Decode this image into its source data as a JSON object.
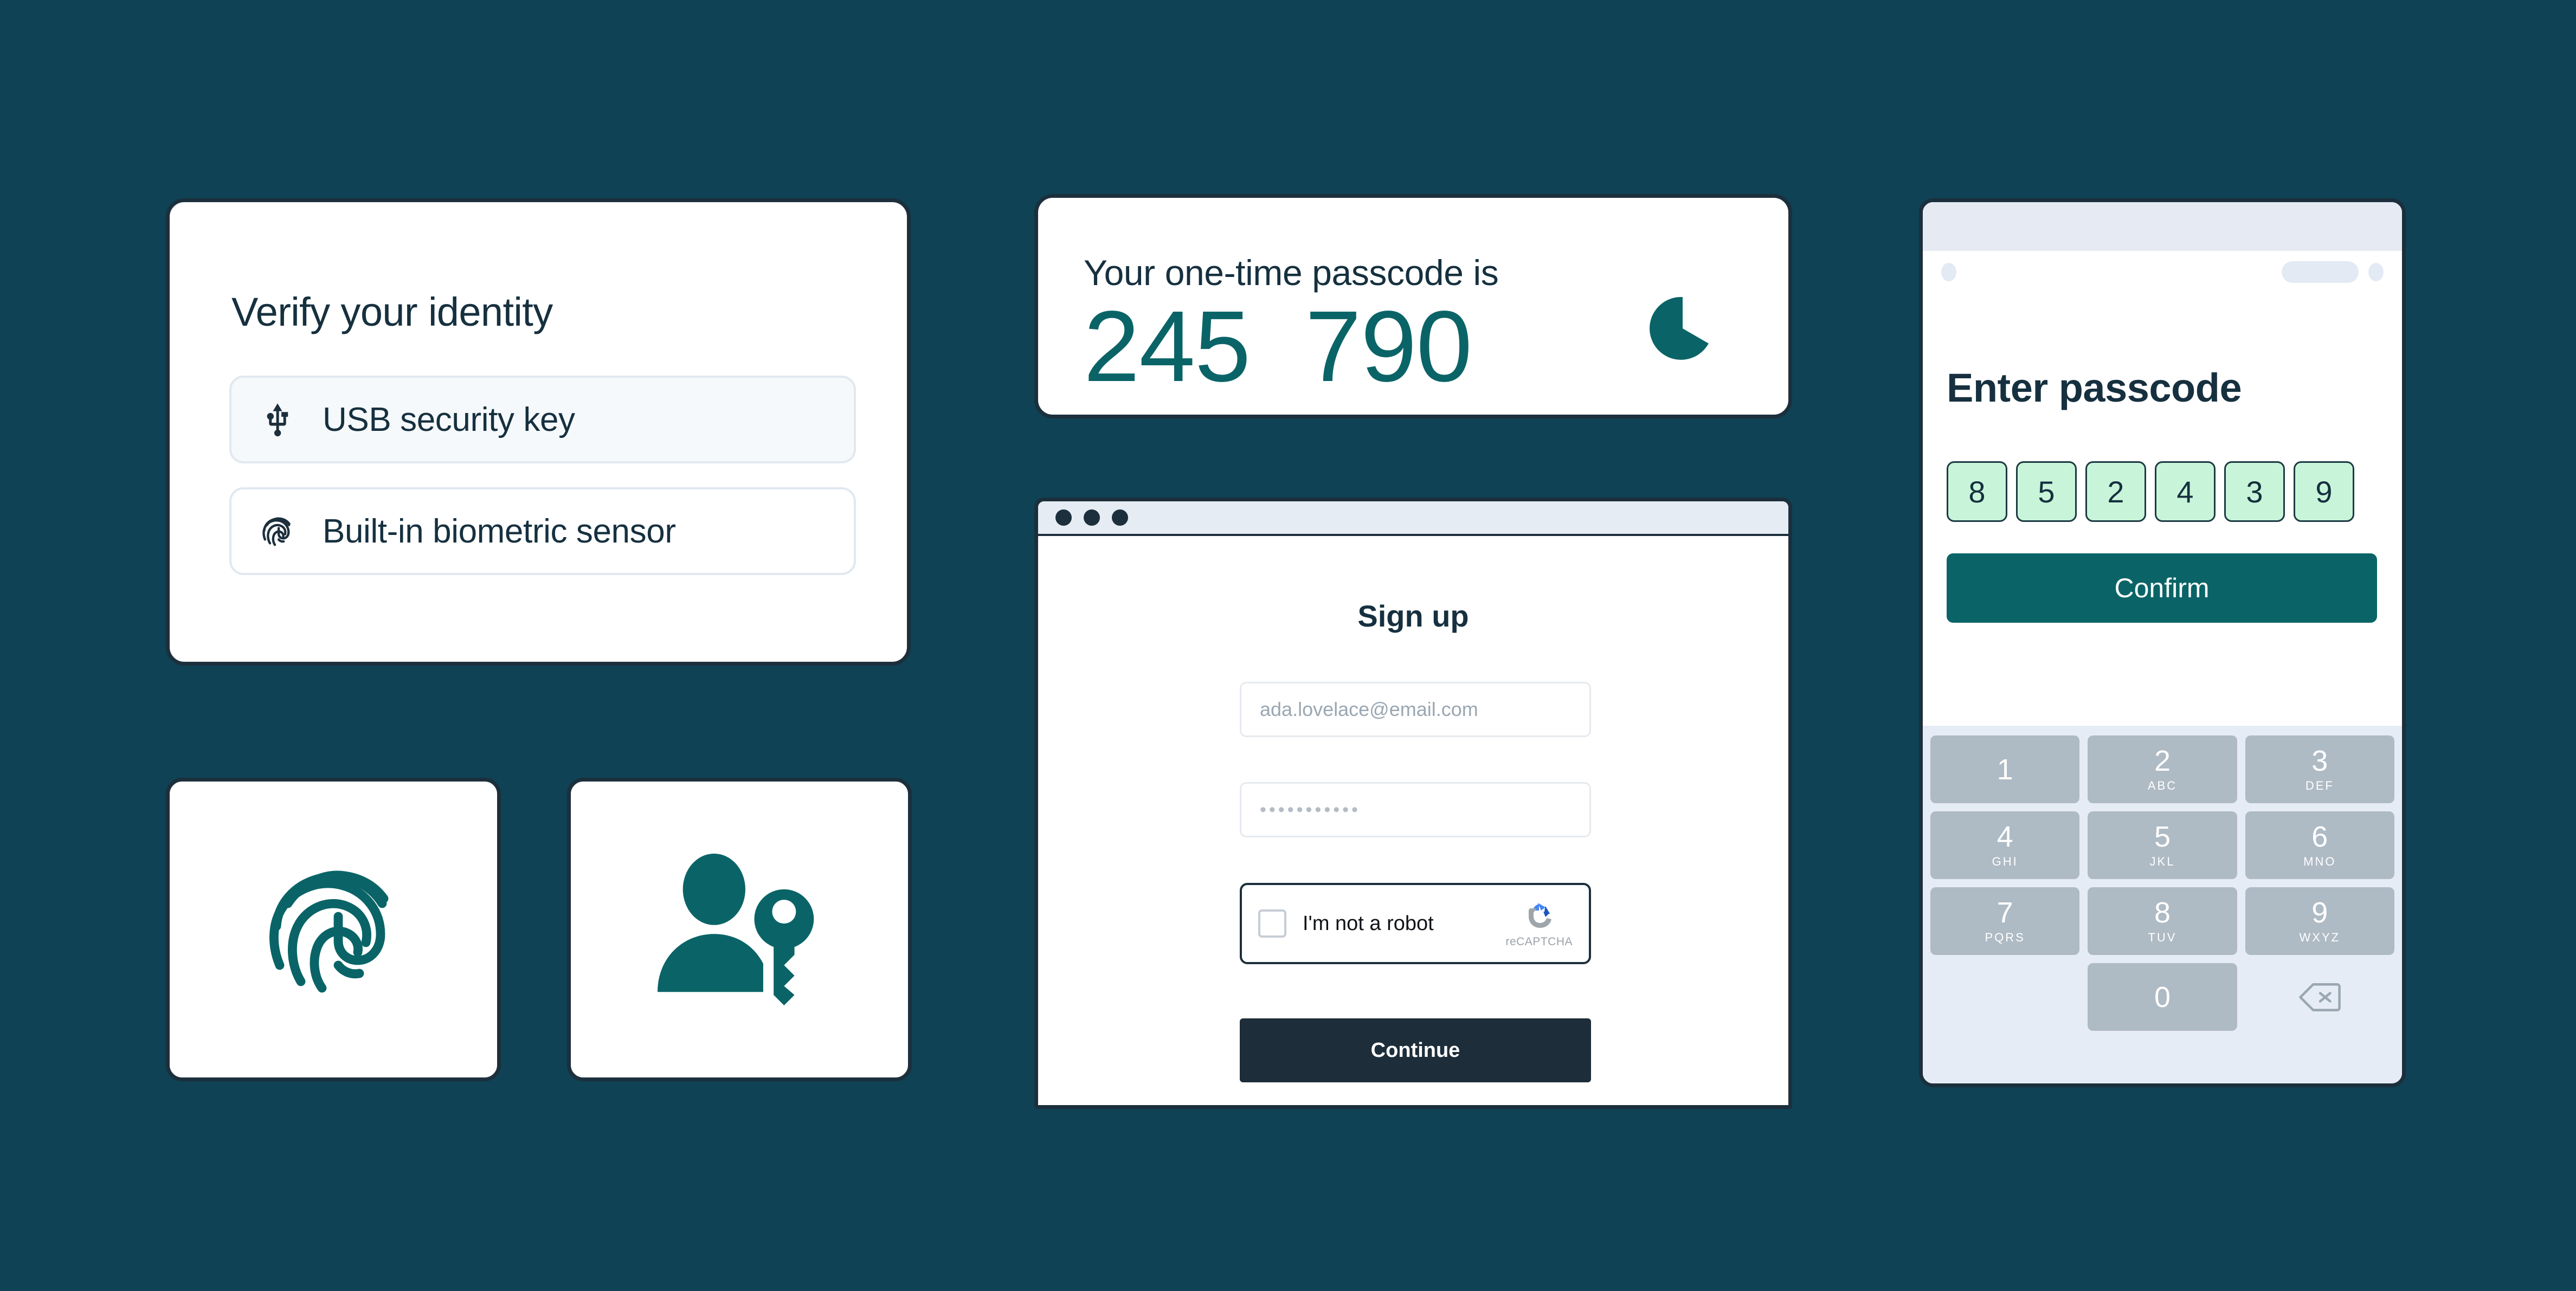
{
  "theme": {
    "background": "#0e4254",
    "card_background": "#ffffff",
    "border_dark": "#1c2f3c",
    "text_dark": "#16303f",
    "teal_accent": "#0a6467",
    "mint": "#c8f5d9",
    "keypad_bg": "#e6ecf5",
    "key_bg": "#aebac4",
    "chrome_bar": "#e6ecf3"
  },
  "verify_card": {
    "title": "Verify your identity",
    "options": [
      {
        "label": "USB security key",
        "icon": "usb-icon",
        "selected": true
      },
      {
        "label": "Built-in biometric sensor",
        "icon": "fingerprint-icon",
        "selected": false
      }
    ]
  },
  "icon_tiles": [
    {
      "icon": "fingerprint-icon",
      "name": "fingerprint"
    },
    {
      "icon": "user-key-icon",
      "name": "user-key"
    }
  ],
  "otp_card": {
    "label": "Your one-time passcode is",
    "code": "245  790",
    "timer_icon": "pie-timer-icon"
  },
  "browser": {
    "titlebar_dots": 3,
    "page": {
      "title": "Sign up",
      "email_field": {
        "value": "",
        "placeholder": "ada.lovelace@email.com"
      },
      "password_field": {
        "value": "•••••••••••",
        "placeholder": ""
      },
      "recaptcha": {
        "label": "I'm not a robot",
        "brand": "reCAPTCHA",
        "checked": false
      },
      "submit_label": "Continue"
    }
  },
  "phone": {
    "title": "Enter passcode",
    "passcode_digits": [
      "8",
      "5",
      "2",
      "4",
      "3",
      "9"
    ],
    "confirm_label": "Confirm",
    "keypad": {
      "rows": [
        [
          {
            "num": "1",
            "sub": ""
          },
          {
            "num": "2",
            "sub": "ABC"
          },
          {
            "num": "3",
            "sub": "DEF"
          }
        ],
        [
          {
            "num": "4",
            "sub": "GHI"
          },
          {
            "num": "5",
            "sub": "JKL"
          },
          {
            "num": "6",
            "sub": "MNO"
          }
        ],
        [
          {
            "num": "7",
            "sub": "PQRS"
          },
          {
            "num": "8",
            "sub": "TUV"
          },
          {
            "num": "9",
            "sub": "WXYZ"
          }
        ],
        [
          {
            "num": "",
            "sub": "",
            "type": "blank"
          },
          {
            "num": "0",
            "sub": ""
          },
          {
            "num": "",
            "sub": "",
            "type": "backspace",
            "icon": "backspace-icon"
          }
        ]
      ]
    }
  }
}
